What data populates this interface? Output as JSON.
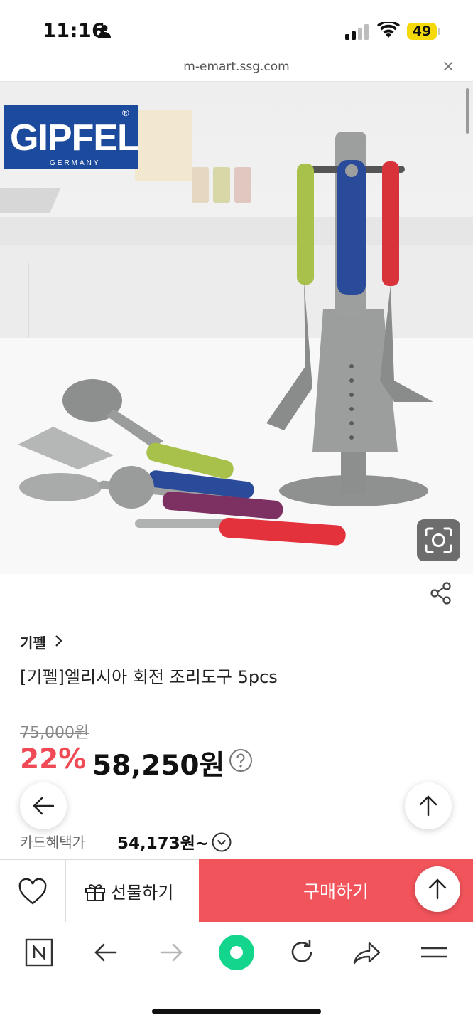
{
  "status_bar": {
    "time": "11:16",
    "battery": "49"
  },
  "browser": {
    "url": "m-emart.ssg.com",
    "close_icon": "×"
  },
  "product": {
    "brand": "기펠",
    "title": "[기펠]엘리시아 회전 조리도구 5pcs",
    "original_price": "75,000원",
    "discount": "22%",
    "price": "58,250원",
    "card_benefit_label": "카드혜택가",
    "card_benefit_price": "54,173원~",
    "image_logo": {
      "text": "GIPFEL",
      "subtext": "GERMANY",
      "mark": "®"
    }
  },
  "buy_bar": {
    "gift_label": "선물하기",
    "buy_label": "구매하기"
  },
  "colors": {
    "accent": "#f2545b",
    "discount": "#ef4a56",
    "logo_blue": "#1c4a9c"
  },
  "icons": {
    "status": [
      "person-icon",
      "signal-icon",
      "wifi-icon",
      "battery-icon"
    ],
    "toolbar": [
      "naver-n-icon",
      "back-arrow-icon",
      "forward-arrow-icon",
      "green-dot-icon",
      "reload-icon",
      "share-arrow-icon",
      "menu-icon"
    ]
  }
}
